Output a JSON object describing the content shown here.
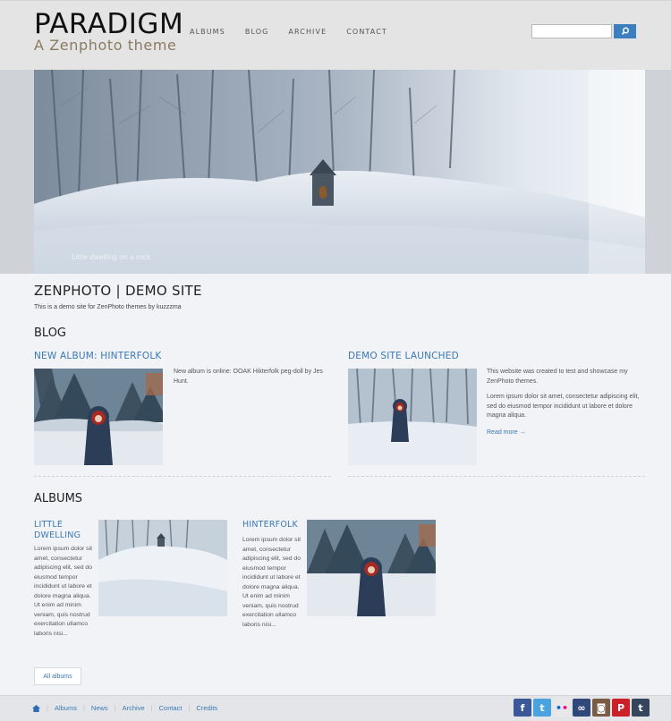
{
  "header": {
    "logo": "PARADIGM",
    "tagline": "A Zenphoto theme",
    "nav": [
      "ALBUMS",
      "BLOG",
      "ARCHIVE",
      "CONTACT"
    ],
    "search_placeholder": ""
  },
  "hero": {
    "caption": "Little dwelling on a rock"
  },
  "intro": {
    "title": "ZENPHOTO | DEMO SITE",
    "description": "This is a demo site for ZenPhoto themes by kuzzzma"
  },
  "blog": {
    "heading": "BLOG",
    "posts": [
      {
        "title": "NEW ALBUM: HINTERFOLK",
        "paragraphs": [
          "New album is online: OOAK Hikterfolk peg-doll by Jes Hunt."
        ]
      },
      {
        "title": "DEMO SITE LAUNCHED",
        "paragraphs": [
          "This website was created to test and showcase my ZenPhoto themes.",
          "Lorem ipsum dolor sit amet, consectetur adipiscing elit, sed do eiusmod tempor incididunt ut labore et dolore magna aliqua."
        ],
        "read_more": "Read more →"
      }
    ]
  },
  "albums": {
    "heading": "ALBUMS",
    "items": [
      {
        "title": "LITTLE DWELLING",
        "text": "Lorem ipsum dolor sit amet, consectetur adipiscing elit, sed do eiusmod tempor incididunt ut labore et dolore magna aliqua. Ut enim ad minim veniam, quis nostrud exercitation ullamco laboris nisi..."
      },
      {
        "title": "HINTERFOLK",
        "text": "Lorem ipsum dolor sit amet, consectetur adipiscing elit, sed do eiusmod tempor incididunt ut labore et dolore magna aliqua. Ut enim ad minim veniam, quis nostrud exercitation ullamco laboris nisi..."
      }
    ],
    "all_albums_label": "All albums"
  },
  "footer": {
    "home_icon": "home-icon",
    "links": [
      "Albums",
      "News",
      "Archive",
      "Contact",
      "Credits"
    ],
    "social": [
      {
        "name": "facebook-icon",
        "glyph": "f",
        "color": "#3b5998"
      },
      {
        "name": "twitter-icon",
        "glyph": "t",
        "color": "#4aa3df"
      },
      {
        "name": "flickr-icon",
        "glyph": "••",
        "color": "#e8e8e8"
      },
      {
        "name": "infinity-icon",
        "glyph": "∞",
        "color": "#2f4a7a"
      },
      {
        "name": "instagram-icon",
        "glyph": "◙",
        "color": "#7a5b44"
      },
      {
        "name": "pinterest-icon",
        "glyph": "P",
        "color": "#cb2027"
      },
      {
        "name": "tumblr-icon",
        "glyph": "t",
        "color": "#35465c"
      }
    ]
  },
  "colors": {
    "accent": "#3a79b5",
    "header_bg": "#e4e4e5",
    "page_bg": "#f1f3f6"
  }
}
